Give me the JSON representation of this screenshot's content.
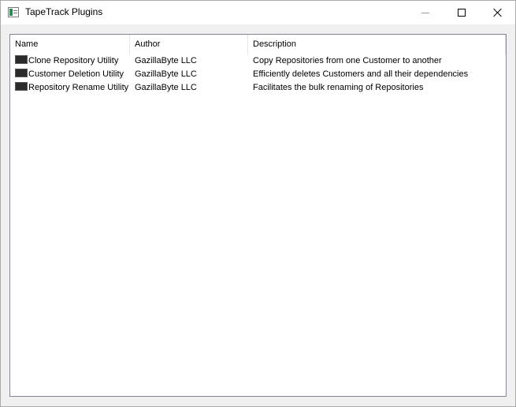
{
  "window": {
    "title": "TapeTrack Plugins",
    "icon": "app-window-icon",
    "controls": {
      "minimize_icon": "minimize-icon",
      "maximize_icon": "maximize-icon",
      "close_icon": "close-icon"
    }
  },
  "plugins_table": {
    "columns": [
      "Name",
      "Author",
      "Description"
    ],
    "rows": [
      {
        "icon": "plugin-icon",
        "name": "Clone Repository Utility",
        "author": "GazillaByte LLC",
        "description": "Copy Repositories from one Customer to another"
      },
      {
        "icon": "plugin-icon",
        "name": "Customer Deletion Utility",
        "author": "GazillaByte LLC",
        "description": "Efficiently deletes Customers and all their dependencies"
      },
      {
        "icon": "plugin-icon",
        "name": "Repository Rename Utility",
        "author": "GazillaByte LLC",
        "description": "Facilitates the bulk renaming of Repositories"
      }
    ]
  }
}
